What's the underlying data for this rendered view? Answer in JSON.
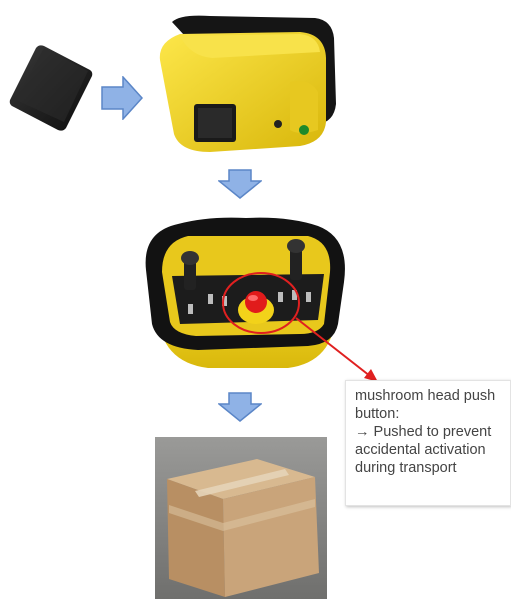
{
  "callout": {
    "line1": "mushroom head push",
    "line2": "button:",
    "line3": "→ Pushed to prevent",
    "line4": "accidental activation",
    "line5": "during transport"
  },
  "colors": {
    "arrow_fill": "#8fb2e6",
    "arrow_stroke": "#5b86c7",
    "device_yellow": "#f2d21a",
    "device_black": "#141414",
    "emergency_red": "#e11b1b",
    "callout_line": "#e02020",
    "box_cardboard": "#c7a57e"
  },
  "icons": [
    "battery-pack-icon",
    "arrow-right-icon",
    "arrow-down-icon",
    "remote-controller-icon",
    "cardboard-box-icon"
  ]
}
